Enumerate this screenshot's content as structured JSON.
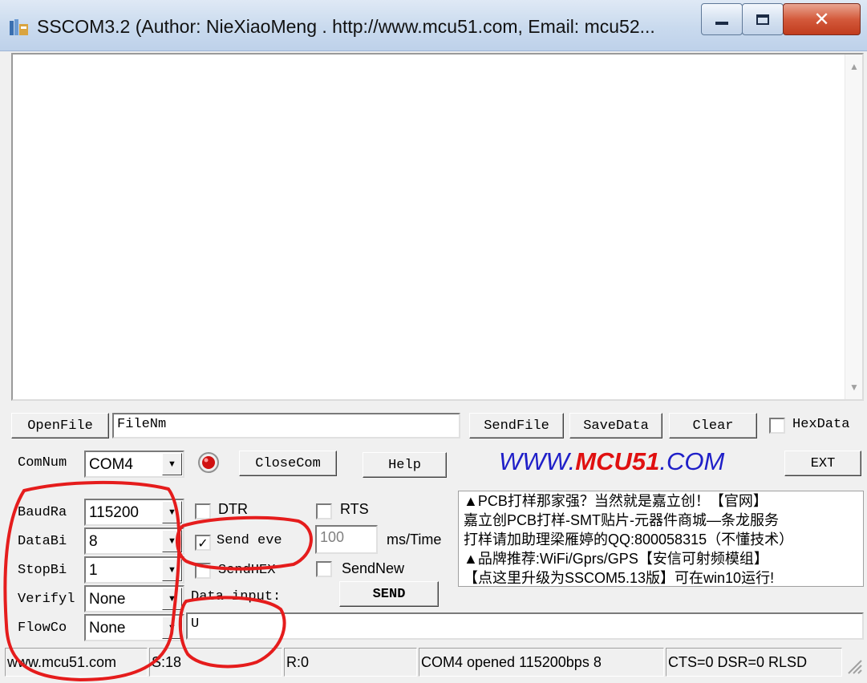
{
  "window": {
    "title": "SSCOM3.2 (Author: NieXiaoMeng .  http://www.mcu51.com,  Email: mcu52...",
    "icon": "app-icon",
    "buttons": {
      "minimize": "minimize-icon",
      "maximize": "maximize-icon",
      "close": "close-icon"
    }
  },
  "file_row": {
    "open_file": "OpenFile",
    "file_name": "FileNm",
    "send_file": "SendFile",
    "save_data": "SaveData",
    "clear": "Clear",
    "hex_data": "HexData",
    "hex_data_checked": false
  },
  "com_row": {
    "com_num_label": "ComNum",
    "com_num_value": "COM4",
    "close_com": "CloseCom",
    "help": "Help",
    "logo_prefix": "WWW.",
    "logo_brand": "MCU51",
    "logo_suffix": ".COM",
    "ext": "EXT",
    "colors": {
      "logo_blue": "#1f1fc8",
      "logo_red": "#e01010",
      "status_led": "#d01010"
    }
  },
  "settings": [
    {
      "label": "BaudRa",
      "value": "115200"
    },
    {
      "label": "DataBi",
      "value": "8"
    },
    {
      "label": "StopBi",
      "value": "1"
    },
    {
      "label": "Verifyl",
      "value": "None"
    },
    {
      "label": "FlowCo",
      "value": "None"
    }
  ],
  "options": {
    "dtr": "DTR",
    "dtr_checked": false,
    "rts": "RTS",
    "rts_checked": false,
    "send_every": "Send eve",
    "send_every_checked": true,
    "interval": "100",
    "interval_unit": "ms/Time",
    "send_hex": "SendHEX",
    "send_hex_checked": false,
    "send_new": "SendNew",
    "send_new_checked": false,
    "data_input_label": "Data input:",
    "send": "SEND",
    "data_input_value": "U"
  },
  "ad_lines": [
    "▲PCB打样那家强？当然就是嘉立创！【官网】",
    "嘉立创PCB打样-SMT贴片-元器件商城—条龙服务",
    "打样请加助理梁雁婷的QQ:800058315（不懂技术）",
    "▲品牌推荐:WiFi/Gprs/GPS【安信可射频模组】",
    "【点这里升级为SSCOM5.13版】可在win10运行!"
  ],
  "status_bar": {
    "site": "www.mcu51.com",
    "sent": "S:18",
    "received": "R:0",
    "port_status": "COM4 opened 115200bps 8",
    "line_status": "CTS=0 DSR=0 RLSD"
  }
}
